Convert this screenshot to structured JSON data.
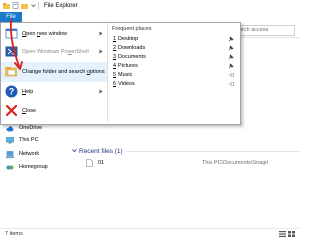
{
  "window": {
    "title": "File Explorer"
  },
  "ribbon": {
    "file_tab": "File"
  },
  "search": {
    "placeholder": "arch access"
  },
  "nav": {
    "items": [
      {
        "label": "OneDrive"
      },
      {
        "label": "This PC"
      },
      {
        "label": "Network"
      },
      {
        "label": "Homegroup"
      }
    ]
  },
  "file_menu": {
    "items": [
      {
        "label": "Open new window",
        "enabled": true,
        "has_submenu": true,
        "icon": "new-window-icon"
      },
      {
        "label": "Open Windows PowerShell",
        "enabled": false,
        "has_submenu": true,
        "icon": "powershell-icon"
      },
      {
        "label": "Change folder and search options",
        "enabled": true,
        "has_submenu": false,
        "icon": "folder-options-icon",
        "highlighted": true
      },
      {
        "label": "Help",
        "enabled": true,
        "has_submenu": true,
        "icon": "help-icon"
      },
      {
        "label": "Close",
        "enabled": true,
        "has_submenu": false,
        "icon": "close-icon"
      }
    ],
    "frequent_title": "Frequent places",
    "frequent": [
      {
        "num": "1",
        "name": "Desktop",
        "pinned": true
      },
      {
        "num": "2",
        "name": "Downloads",
        "pinned": true
      },
      {
        "num": "3",
        "name": "Documents",
        "pinned": true
      },
      {
        "num": "4",
        "name": "Pictures",
        "pinned": true
      },
      {
        "num": "5",
        "name": "Music",
        "pinned": false
      },
      {
        "num": "6",
        "name": "Videos",
        "pinned": false
      }
    ]
  },
  "recent": {
    "header": "Recent files (1)",
    "files": [
      {
        "name": "01",
        "path": "This PC\\Documents\\Snagit"
      }
    ]
  },
  "status": {
    "text": "7 items"
  },
  "colors": {
    "accent": "#1979ca",
    "annotation_arrow": "#e0201b",
    "menu_highlight": "#e5f1fb"
  }
}
